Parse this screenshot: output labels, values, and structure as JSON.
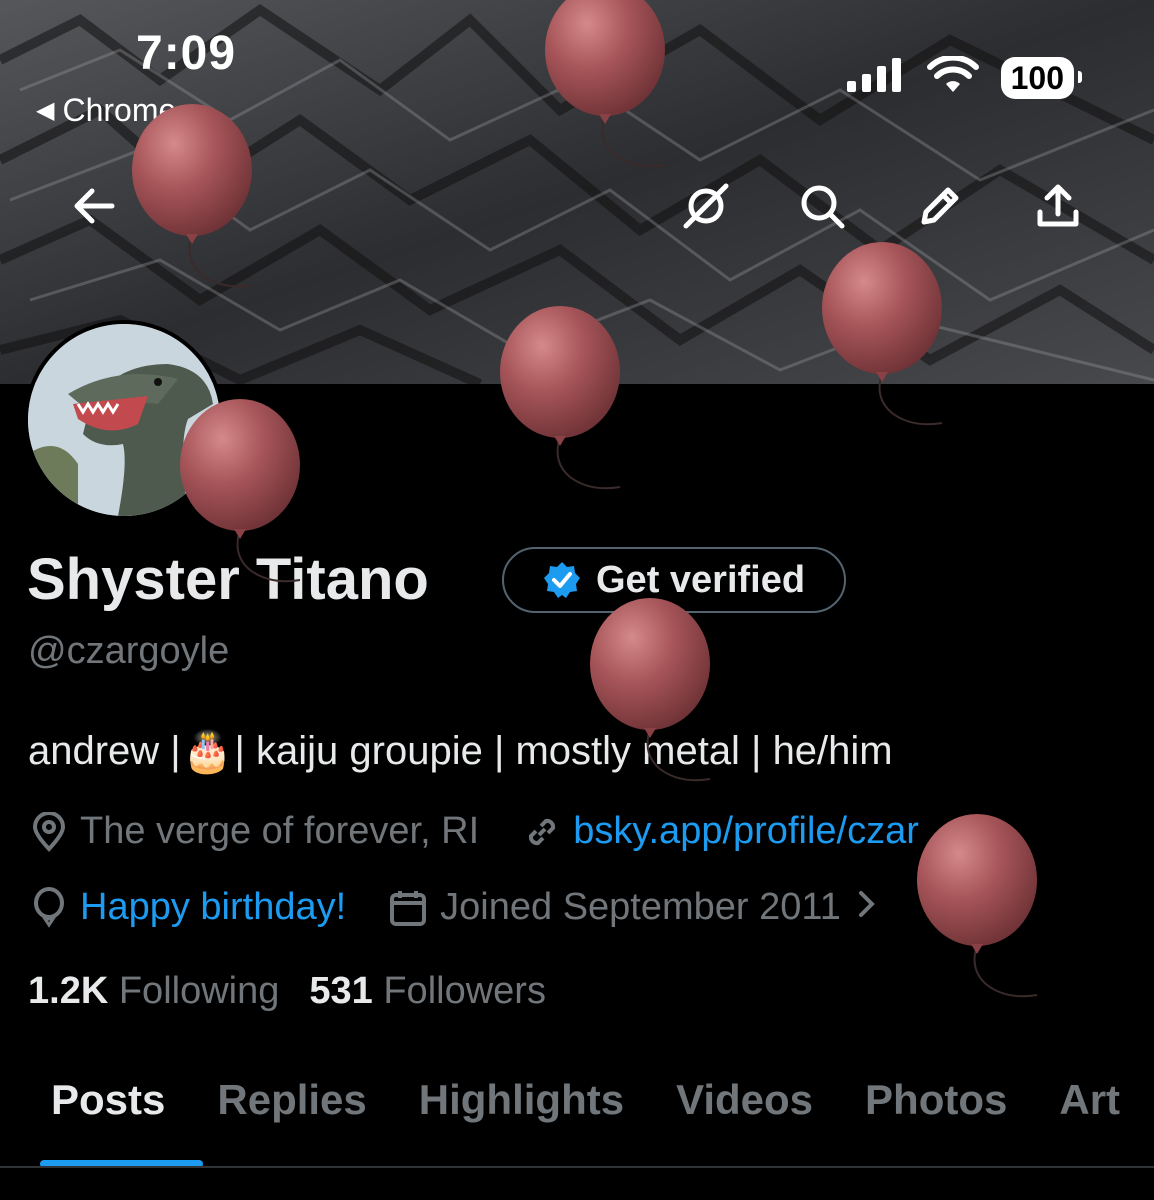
{
  "status_bar": {
    "time": "7:09",
    "back_app": "Chrome",
    "battery": "100"
  },
  "profile": {
    "name": "Shyster Titano",
    "verify_button": "Get verified",
    "handle": "@czargoyle",
    "bio_before": "andrew |",
    "bio_emoji": "🎂",
    "bio_after": "| kaiju groupie | mostly metal | he/him",
    "location": "The verge of forever, RI",
    "website": "bsky.app/profile/czar",
    "birthday": "Happy birthday!",
    "joined": "Joined September 2011",
    "following_count": "1.2K",
    "following_label": "Following",
    "followers_count": "531",
    "followers_label": "Followers"
  },
  "tabs": [
    "Posts",
    "Replies",
    "Highlights",
    "Videos",
    "Photos",
    "Art"
  ],
  "colors": {
    "accent": "#1d9bf0",
    "muted": "#71767b",
    "text": "#e7e9ea",
    "balloon": "#a8565a"
  },
  "icons": [
    "back-arrow-icon",
    "grok-icon",
    "search-icon",
    "pencil-icon",
    "share-icon",
    "location-icon",
    "link-icon",
    "balloon-icon",
    "calendar-icon",
    "verified-badge-icon",
    "chevron-right-icon"
  ]
}
